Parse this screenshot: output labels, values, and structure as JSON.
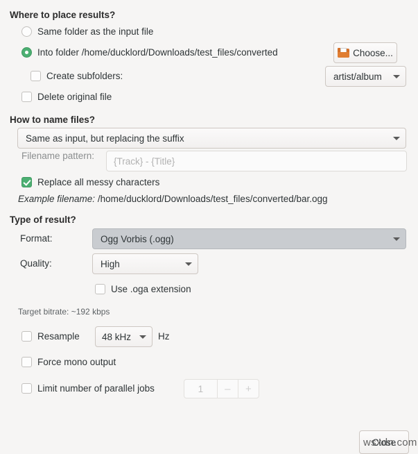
{
  "colors": {
    "background": "#f6f5f4",
    "accent_green": "#4caf72",
    "text": "#2e3436",
    "dim_text": "#8b8e8f",
    "combo_selected_bg": "#c9ccd0",
    "folder_icon": "#d4712a"
  },
  "sections": {
    "where": {
      "header": "Where to place results?",
      "radio_same_folder": {
        "label": "Same folder as the input file",
        "checked": false
      },
      "radio_into_folder": {
        "label": "Into folder /home/ducklord/Downloads/test_files/converted",
        "checked": true
      },
      "choose_button": {
        "label": "Choose...",
        "icon": "folder-open-icon"
      },
      "create_subfolders": {
        "label": "Create subfolders:",
        "checked": false
      },
      "subfolders_combo": {
        "value": "artist/album"
      },
      "delete_original": {
        "label": "Delete original file",
        "checked": false
      }
    },
    "naming": {
      "header": "How to name files?",
      "name_scheme_combo": {
        "value": "Same as input, but replacing the suffix"
      },
      "filename_pattern": {
        "label": "Filename pattern:",
        "placeholder": "{Track} - {Title}",
        "value": "",
        "disabled": true
      },
      "replace_messy": {
        "label": "Replace all messy characters",
        "checked": true
      },
      "example": {
        "prefix": "Example filename:",
        "path": "/home/ducklord/Downloads/test_files/converted/bar.ogg"
      }
    },
    "result": {
      "header": "Type of result?",
      "format": {
        "label": "Format:",
        "value": "Ogg Vorbis (.ogg)"
      },
      "quality": {
        "label": "Quality:",
        "value": "High"
      },
      "use_oga": {
        "label": "Use .oga extension",
        "checked": false
      },
      "target_bitrate": "Target bitrate: ~192 kbps",
      "resample": {
        "label": "Resample",
        "checked": false,
        "rate": "48 kHz",
        "unit": "Hz"
      },
      "force_mono": {
        "label": "Force mono output",
        "checked": false
      },
      "limit_jobs": {
        "label": "Limit number of parallel jobs",
        "checked": false,
        "value": "1",
        "decrement": "–",
        "increment": "+"
      }
    }
  },
  "footer": {
    "close_button": "Close"
  },
  "watermark": "wsxdn.com"
}
